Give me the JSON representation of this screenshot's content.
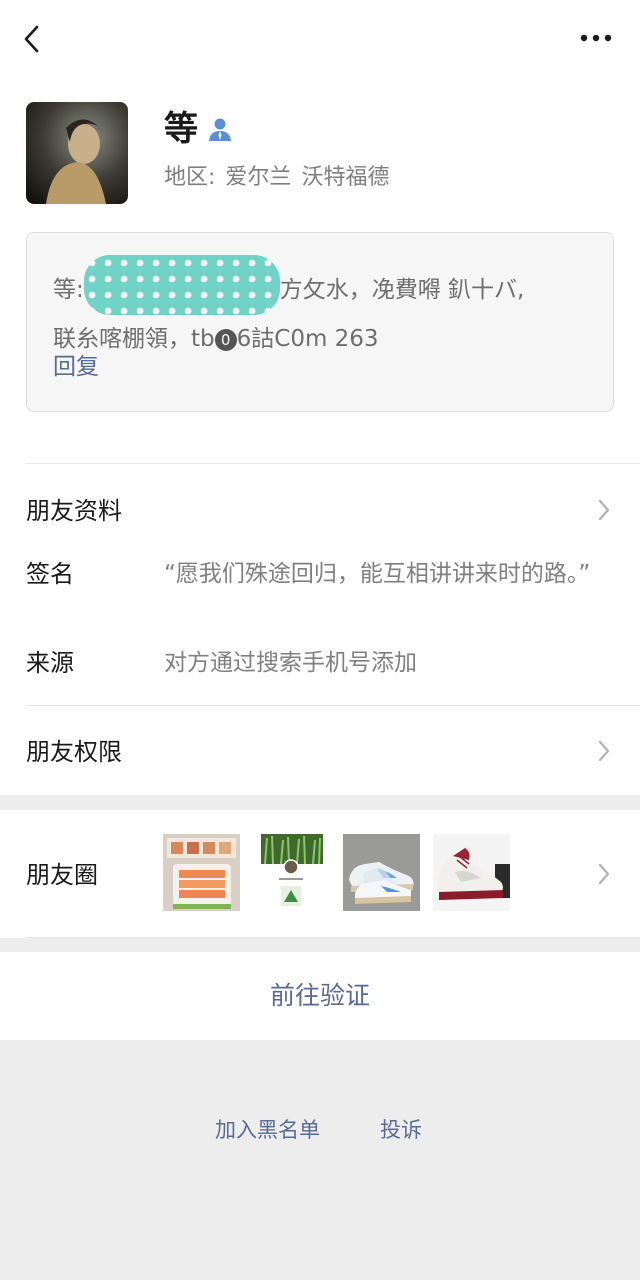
{
  "nav": {
    "back_icon": "chevron-left-icon",
    "more_icon": "ellipsis-icon"
  },
  "profile": {
    "name": "等",
    "contact_icon": "person-icon",
    "region_label": "地区:",
    "region_country": "爱尔兰",
    "region_city": "沃特福德"
  },
  "greeting": {
    "prefix": "等:",
    "text_after_blur": "方攵水，凂費嘚 釟十バ,",
    "line2": "联糸喀棚領，tb",
    "circled": "0",
    "line2_rest": "6詁C0m 263",
    "reply_label": "回复"
  },
  "details": {
    "friend_info_label": "朋友资料",
    "signature_label": "签名",
    "signature_value": "“愿我们殊途回归，能互相讲讲来时的路。”",
    "source_label": "来源",
    "source_value": "对方通过搜索手机号添加",
    "permissions_label": "朋友权限"
  },
  "moments": {
    "label": "朋友圈",
    "thumbnails": [
      "food-photo",
      "poster-photo",
      "sneaker-photo-blue",
      "sneaker-photo-red"
    ]
  },
  "actions": {
    "verify_label": "前往验证",
    "blacklist_label": "加入黑名单",
    "report_label": "投诉"
  },
  "colors": {
    "link": "#576b95",
    "background": "#ededed",
    "secondary_text": "#7f7f7f"
  }
}
